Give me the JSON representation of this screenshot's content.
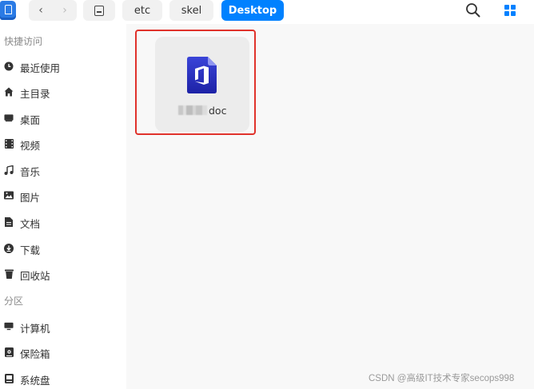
{
  "toolbar": {
    "back_glyph": "‹",
    "forward_glyph": "›",
    "breadcrumbs": [
      "etc",
      "skel",
      "Desktop"
    ],
    "active_crumb": "Desktop",
    "accent_color": "#0081ff"
  },
  "sidebar": {
    "quick_access_title": "快捷访问",
    "quick_access": [
      {
        "label": "最近使用",
        "icon": "clock-icon"
      },
      {
        "label": "主目录",
        "icon": "home-icon"
      },
      {
        "label": "桌面",
        "icon": "desktop-icon"
      },
      {
        "label": "视频",
        "icon": "video-icon"
      },
      {
        "label": "音乐",
        "icon": "music-icon"
      },
      {
        "label": "图片",
        "icon": "picture-icon"
      },
      {
        "label": "文档",
        "icon": "document-icon"
      },
      {
        "label": "下载",
        "icon": "download-icon"
      },
      {
        "label": "回收站",
        "icon": "trash-icon"
      }
    ],
    "partitions_title": "分区",
    "partitions": [
      {
        "label": "计算机",
        "icon": "computer-icon"
      },
      {
        "label": "保险箱",
        "icon": "vault-icon"
      },
      {
        "label": "系统盘",
        "icon": "system-disk-icon"
      }
    ]
  },
  "files": [
    {
      "name_visible": "doc",
      "name_obscured": true,
      "icon": "office-document-icon"
    }
  ],
  "highlight_color": "#e0322b",
  "watermark": "CSDN @高级IT技术专家secops998"
}
